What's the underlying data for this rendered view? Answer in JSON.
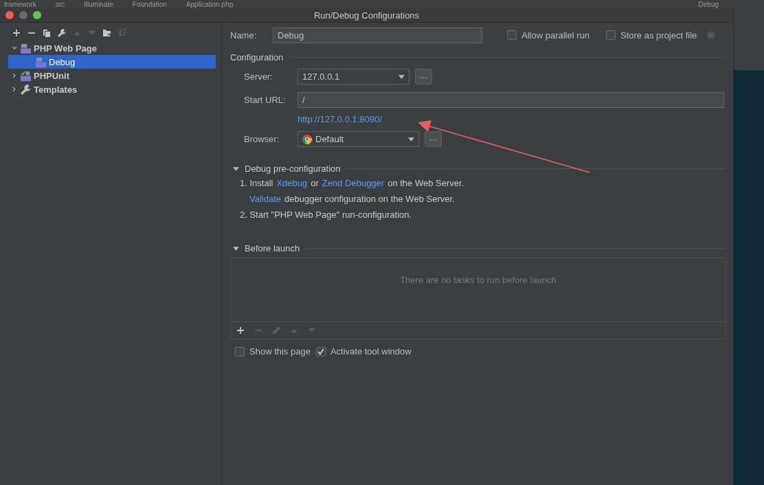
{
  "background": {
    "breadcrumbs": [
      "framework",
      "src",
      "Illuminate",
      "Foundation",
      "Application.php"
    ],
    "run_config": "Debug"
  },
  "window": {
    "title": "Run/Debug Configurations"
  },
  "toolbar": [
    {
      "kind": "add",
      "disabled": false
    },
    {
      "kind": "remove",
      "disabled": false
    },
    {
      "kind": "copy",
      "disabled": false
    },
    {
      "kind": "edit",
      "disabled": false
    },
    {
      "kind": "up",
      "disabled": true
    },
    {
      "kind": "down",
      "disabled": true
    },
    {
      "kind": "folder",
      "disabled": false
    },
    {
      "kind": "sort",
      "disabled": true
    }
  ],
  "tree": [
    {
      "label": "PHP Web Page",
      "kind": "php",
      "expanded": true,
      "selected": false,
      "children": [
        {
          "label": "Debug",
          "kind": "php",
          "selected": true
        }
      ]
    },
    {
      "label": "PHPUnit",
      "kind": "phpunit",
      "expanded": false,
      "selected": false
    },
    {
      "label": "Templates",
      "kind": "templates",
      "expanded": false,
      "selected": false
    }
  ],
  "name": {
    "label": "Name:",
    "value": "Debug"
  },
  "options": [
    {
      "label": "Allow parallel run",
      "checked": false
    },
    {
      "label": "Store as project file",
      "checked": false
    }
  ],
  "configuration": {
    "title": "Configuration",
    "server": {
      "label": "Server:",
      "value": "127.0.0.1",
      "button": "..."
    },
    "start_url": {
      "label": "Start URL:",
      "value": "/"
    },
    "resolved_url": "http://127.0.0.1:8090/",
    "browser": {
      "label": "Browser:",
      "value": "Default",
      "button": "..."
    }
  },
  "pre_config": {
    "title": "Debug pre-configuration",
    "expanded": true,
    "lines": [
      [
        {
          "text": "1. Install",
          "link": false
        },
        {
          "text": "Xdebug",
          "link": true
        },
        {
          "text": "or",
          "link": false
        },
        {
          "text": "Zend Debugger",
          "link": true
        },
        {
          "text": "on the Web Server.",
          "link": false
        }
      ],
      [
        {
          "text": "Validate",
          "link": true
        },
        {
          "text": "debugger configuration on the Web Server.",
          "link": false
        }
      ],
      [
        {
          "text": "2. Start \"PHP Web Page\" run-configuration.",
          "link": false
        }
      ]
    ]
  },
  "before_launch": {
    "title": "Before launch",
    "expanded": true,
    "empty_text": "There are no tasks to run before launch",
    "toolbar": [
      {
        "kind": "add",
        "disabled": false
      },
      {
        "kind": "remove",
        "disabled": true
      },
      {
        "kind": "edit",
        "disabled": true
      },
      {
        "kind": "up",
        "disabled": true
      },
      {
        "kind": "down",
        "disabled": true
      }
    ]
  },
  "footer_options": [
    {
      "label": "Show this page",
      "checked": false
    },
    {
      "label": "Activate tool window",
      "checked": true
    }
  ]
}
